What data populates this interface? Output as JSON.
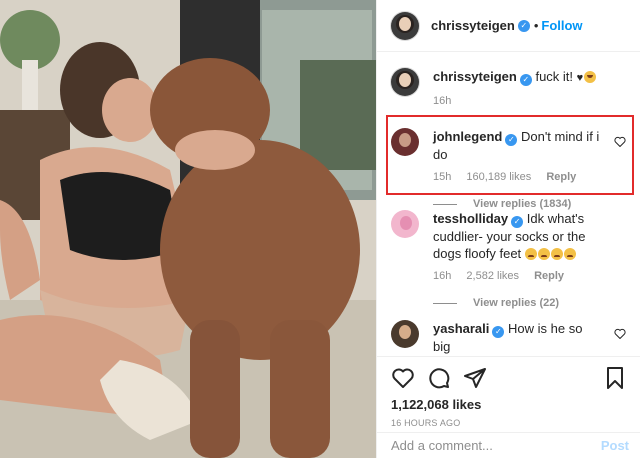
{
  "post": {
    "author": "chrissyteigen",
    "follow_label": "Follow",
    "dot": "•",
    "caption_text": "fuck it! ",
    "caption_time": "16h",
    "photo_alt": "photo"
  },
  "comments": [
    {
      "user": "johnlegend",
      "text": "Don't mind if i do",
      "time": "15h",
      "likes": "160,189 likes",
      "reply": "Reply",
      "view_replies": "View replies (1834)"
    },
    {
      "user": "tessholliday",
      "text": "Idk what's cuddlier- your socks or the dogs floofy feet",
      "time": "16h",
      "likes": "2,582 likes",
      "reply": "Reply",
      "view_replies": "View replies (22)"
    },
    {
      "user": "yasharali",
      "text": "How is he so big"
    }
  ],
  "footer": {
    "likes": "1,122,068 likes",
    "timestamp": "16 HOURS AGO",
    "add_comment_placeholder": "Add a comment...",
    "post_label": "Post"
  },
  "colors": {
    "accent": "#0095f6",
    "highlight": "#e22b2b",
    "verified": "#3897f0"
  },
  "icons": [
    "verified-icon",
    "heart-icon",
    "comment-icon",
    "share-icon",
    "bookmark-icon"
  ]
}
